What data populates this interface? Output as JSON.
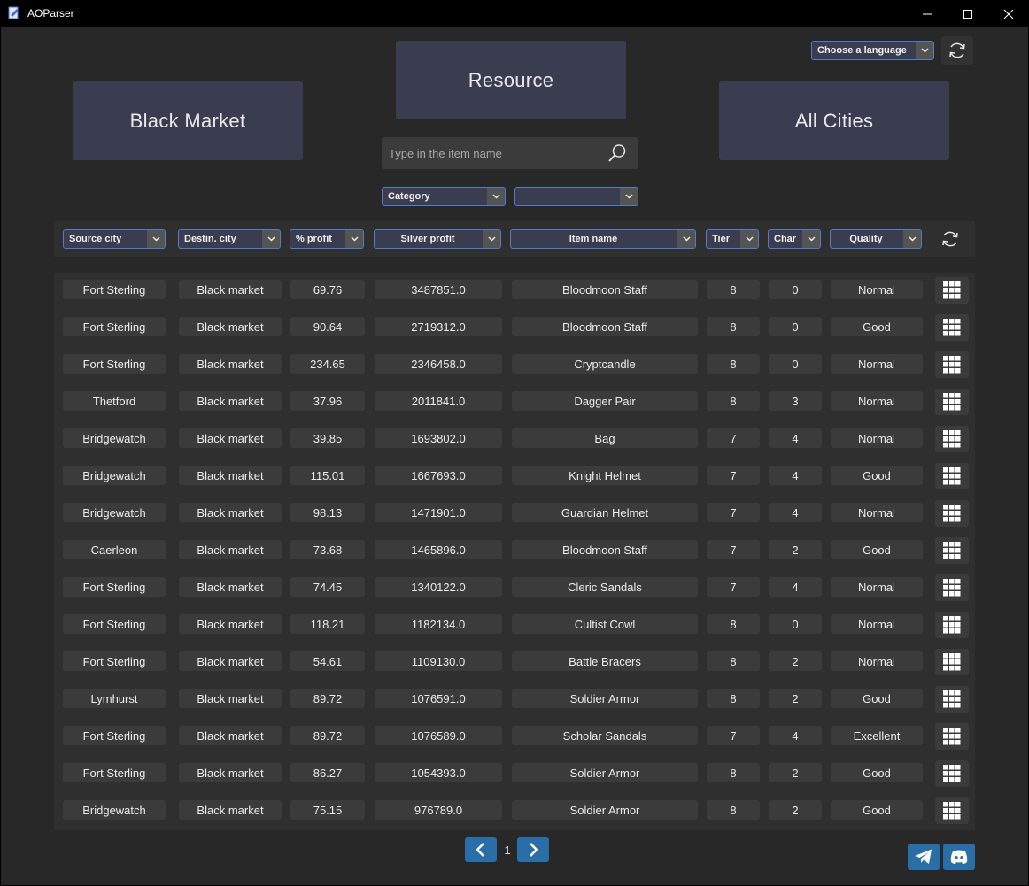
{
  "window": {
    "title": "AOParser"
  },
  "top": {
    "resource_label": "Resource",
    "black_market_label": "Black Market",
    "all_cities_label": "All Cities",
    "language_select": "Choose a language",
    "search_placeholder": "Type in the item name",
    "category_select": "Category",
    "subcategory_select": ""
  },
  "filters": {
    "source_city": "Source city",
    "destin_city": "Destin. city",
    "percent_profit": "% profit",
    "silver_profit": "Silver profit",
    "item_name": "Item name",
    "tier": "Tier",
    "char": "Char",
    "quality": "Quality"
  },
  "rows": [
    {
      "source": "Fort Sterling",
      "dest": "Black market",
      "pct": "69.76",
      "silver": "3487851.0",
      "item": "Bloodmoon Staff",
      "tier": "8",
      "char": "0",
      "quality": "Normal"
    },
    {
      "source": "Fort Sterling",
      "dest": "Black market",
      "pct": "90.64",
      "silver": "2719312.0",
      "item": "Bloodmoon Staff",
      "tier": "8",
      "char": "0",
      "quality": "Good"
    },
    {
      "source": "Fort Sterling",
      "dest": "Black market",
      "pct": "234.65",
      "silver": "2346458.0",
      "item": "Cryptcandle",
      "tier": "8",
      "char": "0",
      "quality": "Normal"
    },
    {
      "source": "Thetford",
      "dest": "Black market",
      "pct": "37.96",
      "silver": "2011841.0",
      "item": "Dagger Pair",
      "tier": "8",
      "char": "3",
      "quality": "Normal"
    },
    {
      "source": "Bridgewatch",
      "dest": "Black market",
      "pct": "39.85",
      "silver": "1693802.0",
      "item": "Bag",
      "tier": "7",
      "char": "4",
      "quality": "Normal"
    },
    {
      "source": "Bridgewatch",
      "dest": "Black market",
      "pct": "115.01",
      "silver": "1667693.0",
      "item": "Knight Helmet",
      "tier": "7",
      "char": "4",
      "quality": "Good"
    },
    {
      "source": "Bridgewatch",
      "dest": "Black market",
      "pct": "98.13",
      "silver": "1471901.0",
      "item": "Guardian Helmet",
      "tier": "7",
      "char": "4",
      "quality": "Normal"
    },
    {
      "source": "Caerleon",
      "dest": "Black market",
      "pct": "73.68",
      "silver": "1465896.0",
      "item": "Bloodmoon Staff",
      "tier": "7",
      "char": "2",
      "quality": "Good"
    },
    {
      "source": "Fort Sterling",
      "dest": "Black market",
      "pct": "74.45",
      "silver": "1340122.0",
      "item": "Cleric Sandals",
      "tier": "7",
      "char": "4",
      "quality": "Normal"
    },
    {
      "source": "Fort Sterling",
      "dest": "Black market",
      "pct": "118.21",
      "silver": "1182134.0",
      "item": "Cultist Cowl",
      "tier": "8",
      "char": "0",
      "quality": "Normal"
    },
    {
      "source": "Fort Sterling",
      "dest": "Black market",
      "pct": "54.61",
      "silver": "1109130.0",
      "item": "Battle Bracers",
      "tier": "8",
      "char": "2",
      "quality": "Normal"
    },
    {
      "source": "Lymhurst",
      "dest": "Black market",
      "pct": "89.72",
      "silver": "1076591.0",
      "item": "Soldier Armor",
      "tier": "8",
      "char": "2",
      "quality": "Good"
    },
    {
      "source": "Fort Sterling",
      "dest": "Black market",
      "pct": "89.72",
      "silver": "1076589.0",
      "item": "Scholar Sandals",
      "tier": "7",
      "char": "4",
      "quality": "Excellent"
    },
    {
      "source": "Fort Sterling",
      "dest": "Black market",
      "pct": "86.27",
      "silver": "1054393.0",
      "item": "Soldier Armor",
      "tier": "8",
      "char": "2",
      "quality": "Good"
    },
    {
      "source": "Bridgewatch",
      "dest": "Black market",
      "pct": "75.15",
      "silver": "976789.0",
      "item": "Soldier Armor",
      "tier": "8",
      "char": "2",
      "quality": "Good"
    }
  ],
  "pagination": {
    "page": "1"
  },
  "colors": {
    "background": "#282828",
    "panel": "#2f2f2f",
    "cell": "#3b3b3b",
    "big_button": "#3a3d50",
    "accent_blue": "#2a6ea8",
    "combo_border": "#4c7fc7"
  }
}
